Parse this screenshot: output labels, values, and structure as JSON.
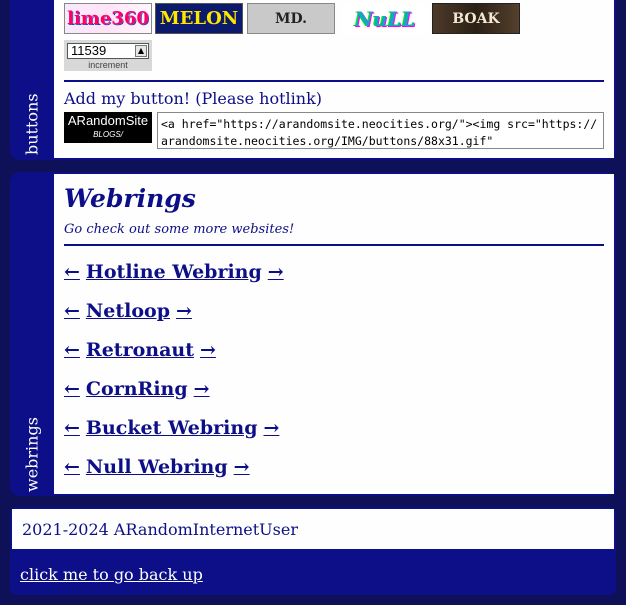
{
  "buttons_section": {
    "side_label": "buttons",
    "badges": [
      {
        "text": "lime360",
        "icon": "lime360-badge"
      },
      {
        "text": "MELON",
        "icon": "melon-badge"
      },
      {
        "text": "MD.",
        "icon": "md-badge"
      },
      {
        "text": "NuLL",
        "icon": "null-badge"
      },
      {
        "text": "BOAK",
        "icon": "boak-badge"
      }
    ],
    "counter": {
      "value": "11539",
      "label": "increment"
    },
    "add_title": "Add my button! (Please hotlink)",
    "site_button": {
      "line1": "ARandomSite",
      "line2": "BLOGS/"
    },
    "embed_code": "<a href=\"https://arandomsite.neocities.org/\"><img src=\"https://arandomsite.neocities.org/IMG/buttons/88x31.gif\""
  },
  "webrings_section": {
    "side_label": "webrings",
    "title": "Webrings",
    "subtitle": "Go check out some more websites!",
    "prev_arrow": "←",
    "next_arrow": "→",
    "rings": [
      {
        "name": "Hotline Webring"
      },
      {
        "name": "Netloop"
      },
      {
        "name": "Retronaut"
      },
      {
        "name": "CornRing"
      },
      {
        "name": "Bucket Webring"
      },
      {
        "name": "Null Webring"
      }
    ]
  },
  "footer": {
    "copyright": "2021-2024 ARandomInternetUser",
    "back_link": "click me to go back up"
  },
  "colors": {
    "background": "#0e1058",
    "accent": "#0c0f87",
    "panel": "#fefefe"
  }
}
